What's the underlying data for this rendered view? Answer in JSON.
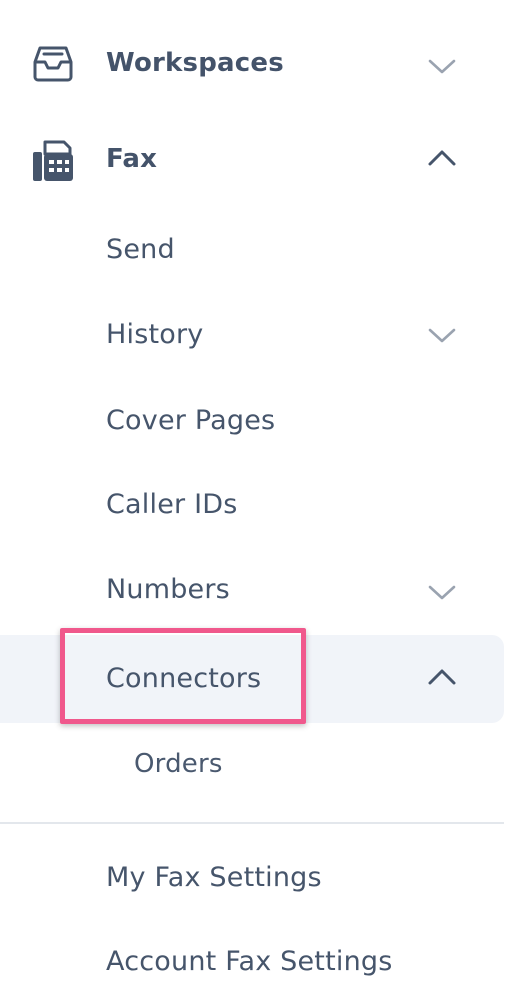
{
  "nav": {
    "workspaces": {
      "label": "Workspaces",
      "icon": "inbox-tray-icon",
      "expanded": false
    },
    "fax": {
      "label": "Fax",
      "icon": "fax-machine-icon",
      "expanded": true
    },
    "fax_items": [
      {
        "label": "Send",
        "has_chevron": false
      },
      {
        "label": "History",
        "has_chevron": true,
        "expanded": false
      },
      {
        "label": "Cover Pages",
        "has_chevron": false
      },
      {
        "label": "Caller IDs",
        "has_chevron": false
      },
      {
        "label": "Numbers",
        "has_chevron": true,
        "expanded": false
      },
      {
        "label": "Connectors",
        "has_chevron": true,
        "expanded": true,
        "active": true
      }
    ],
    "connectors_items": [
      {
        "label": "Orders"
      }
    ],
    "settings_items": [
      {
        "label": "My Fax Settings"
      },
      {
        "label": "Account Fax Settings"
      }
    ]
  },
  "colors": {
    "text": "#46556b",
    "chevron": "#9aa3b0",
    "active_background": "#f1f4f9",
    "highlight_border": "#f0588c",
    "divider": "#e3e7ec"
  }
}
